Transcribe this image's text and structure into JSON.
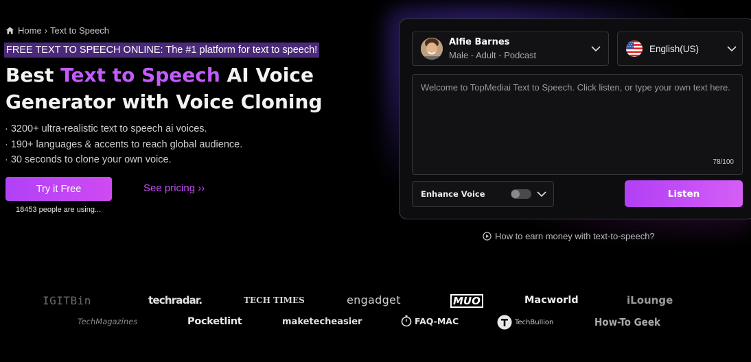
{
  "breadcrumb": {
    "home": "Home",
    "separator": "›",
    "current": "Text to Speech"
  },
  "tagline": "FREE TEXT TO SPEECH ONLINE: The #1 platform for text to speech!",
  "hero": {
    "title_part1": "Best ",
    "title_accent": "Text to Speech",
    "title_part2": " AI Voice Generator with Voice Cloning",
    "accent_color": "#c45bff"
  },
  "features": [
    "· 3200+ ultra-realistic text to speech ai voices.",
    "· 190+ languages & accents to reach global audience.",
    "· 30 seconds to clone your own voice."
  ],
  "cta": {
    "try_label": "Try it Free",
    "pricing_label": "See pricing ››",
    "user_count": "18453 people are using..."
  },
  "panel": {
    "voice": {
      "name": "Alfie Barnes",
      "meta": "Male - Adult - Podcast"
    },
    "language": {
      "label": "English(US)"
    },
    "text": {
      "placeholder": "Welcome to TopMediai Text to Speech. Click listen, or type your own text here.",
      "char_count": "78/100"
    },
    "enhance_label": "Enhance Voice",
    "enhance_on": false,
    "listen_label": "Listen"
  },
  "earn_link": "How to earn money with text-to-speech?",
  "logos": {
    "row1": [
      "IGITBin",
      "techradar.",
      "TECH TIMES",
      "engadget",
      "MUO",
      "Macworld",
      "iLounge"
    ],
    "row2": [
      "TechMagazines",
      "Pocketlint",
      "maketecheasier",
      "FAQ-MAC",
      "TechBullion",
      "How-To Geek"
    ]
  },
  "colors": {
    "background": "#000000",
    "accent": "#c45bff",
    "button_gradient_start": "#b042f7",
    "button_gradient_end": "#cf4af2"
  }
}
